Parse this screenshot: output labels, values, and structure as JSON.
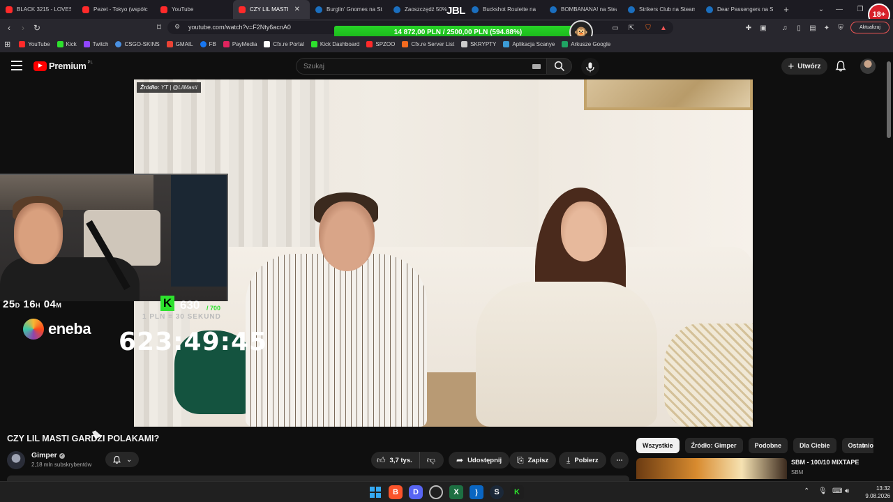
{
  "browser": {
    "tabs": [
      {
        "label": "BLACK 3215 - LOVEST",
        "icon": "youtube-icon",
        "active": false
      },
      {
        "label": "Pezet - Tokyo (współc",
        "icon": "youtube-icon",
        "active": false
      },
      {
        "label": "YouTube",
        "icon": "youtube-icon",
        "active": false
      },
      {
        "label": "CZY LIL MASTI",
        "icon": "youtube-icon",
        "active": true
      },
      {
        "label": "Burglin' Gnomes na St",
        "icon": "steam-icon",
        "active": false
      },
      {
        "label": "Zaoszczędź 50%",
        "icon": "steam-icon",
        "active": false
      },
      {
        "label": "Buckshot Roulette na",
        "icon": "steam-icon",
        "active": false
      },
      {
        "label": "BOMBANANA! na Stea",
        "icon": "steam-icon",
        "active": false
      },
      {
        "label": "Strikers Club na Steam",
        "icon": "steam-icon",
        "active": false
      },
      {
        "label": "Dear Passengers na St",
        "icon": "steam-icon",
        "active": false
      }
    ],
    "overlay_brand": "JBL",
    "age_badge": "18+",
    "url": "youtube.com/watch?v=F2Nty6acnA0",
    "update_label": "Aktualizuj",
    "bookmarks": [
      {
        "label": "YouTube",
        "color": "#ff2a2a"
      },
      {
        "label": "Kick",
        "color": "#2de12d"
      },
      {
        "label": "Twitch",
        "color": "#9146ff"
      },
      {
        "label": "CSGO-SKINS",
        "color": "#4a90e2"
      },
      {
        "label": "GMAIL",
        "color": "#ea4335"
      },
      {
        "label": "FB",
        "color": "#1877f2"
      },
      {
        "label": "PayMedia",
        "color": "#e0245e"
      },
      {
        "label": "Cfx.re Portal",
        "color": "#ffffff"
      },
      {
        "label": "Kick Dashboard",
        "color": "#2de12d"
      },
      {
        "label": "SPZOO",
        "color": "#ff2a2a"
      },
      {
        "label": "Cfx.re Server List",
        "color": "#f46a1f"
      },
      {
        "label": "SKRYPTY",
        "color": "#cccccc"
      },
      {
        "label": "Aplikacja Scanye",
        "color": "#3c9cd7"
      },
      {
        "label": "Arkusze Google",
        "color": "#1fa463"
      }
    ]
  },
  "donation_goal": {
    "text": "14 872,00 PLN / 2500,00 PLN (594.88%)",
    "fraction": 1.0,
    "color": "#19b519"
  },
  "youtube": {
    "logo_text": "Premium",
    "logo_region": "PL",
    "search_placeholder": "Szukaj",
    "create_label": "Utwórz"
  },
  "video": {
    "source_label_prefix": "Źródło:",
    "source_label_value": "YT | @LilMasti"
  },
  "stream_overlay": {
    "days_timer_d": "25",
    "days_timer_h": "16",
    "days_timer_m": "04",
    "sponsor": "eneba",
    "sub_count": "630",
    "sub_goal": "/ 700",
    "pln_label": "1 PLN = 30 SEKUND",
    "big_timer": "623:49:45"
  },
  "watch": {
    "title": "CZY LIL MASTI GARDZI POLAKAMI?",
    "channel_name": "Gimper",
    "subscribers": "2,18 mln subskrybentów",
    "likes": "3,7 tys.",
    "share_label": "Udostępnij",
    "save_label": "Zapisz",
    "download_label": "Pobierz",
    "chips": [
      "Wszystkie",
      "Źródło: Gimper",
      "Podobne",
      "Dla Ciebie",
      "Ostatnio"
    ],
    "rec_title": "SBM - 100/10 MIXTAPE",
    "rec_channel": "SBM"
  },
  "taskbar": {
    "time": "13:32",
    "date": "9.08.2026"
  }
}
